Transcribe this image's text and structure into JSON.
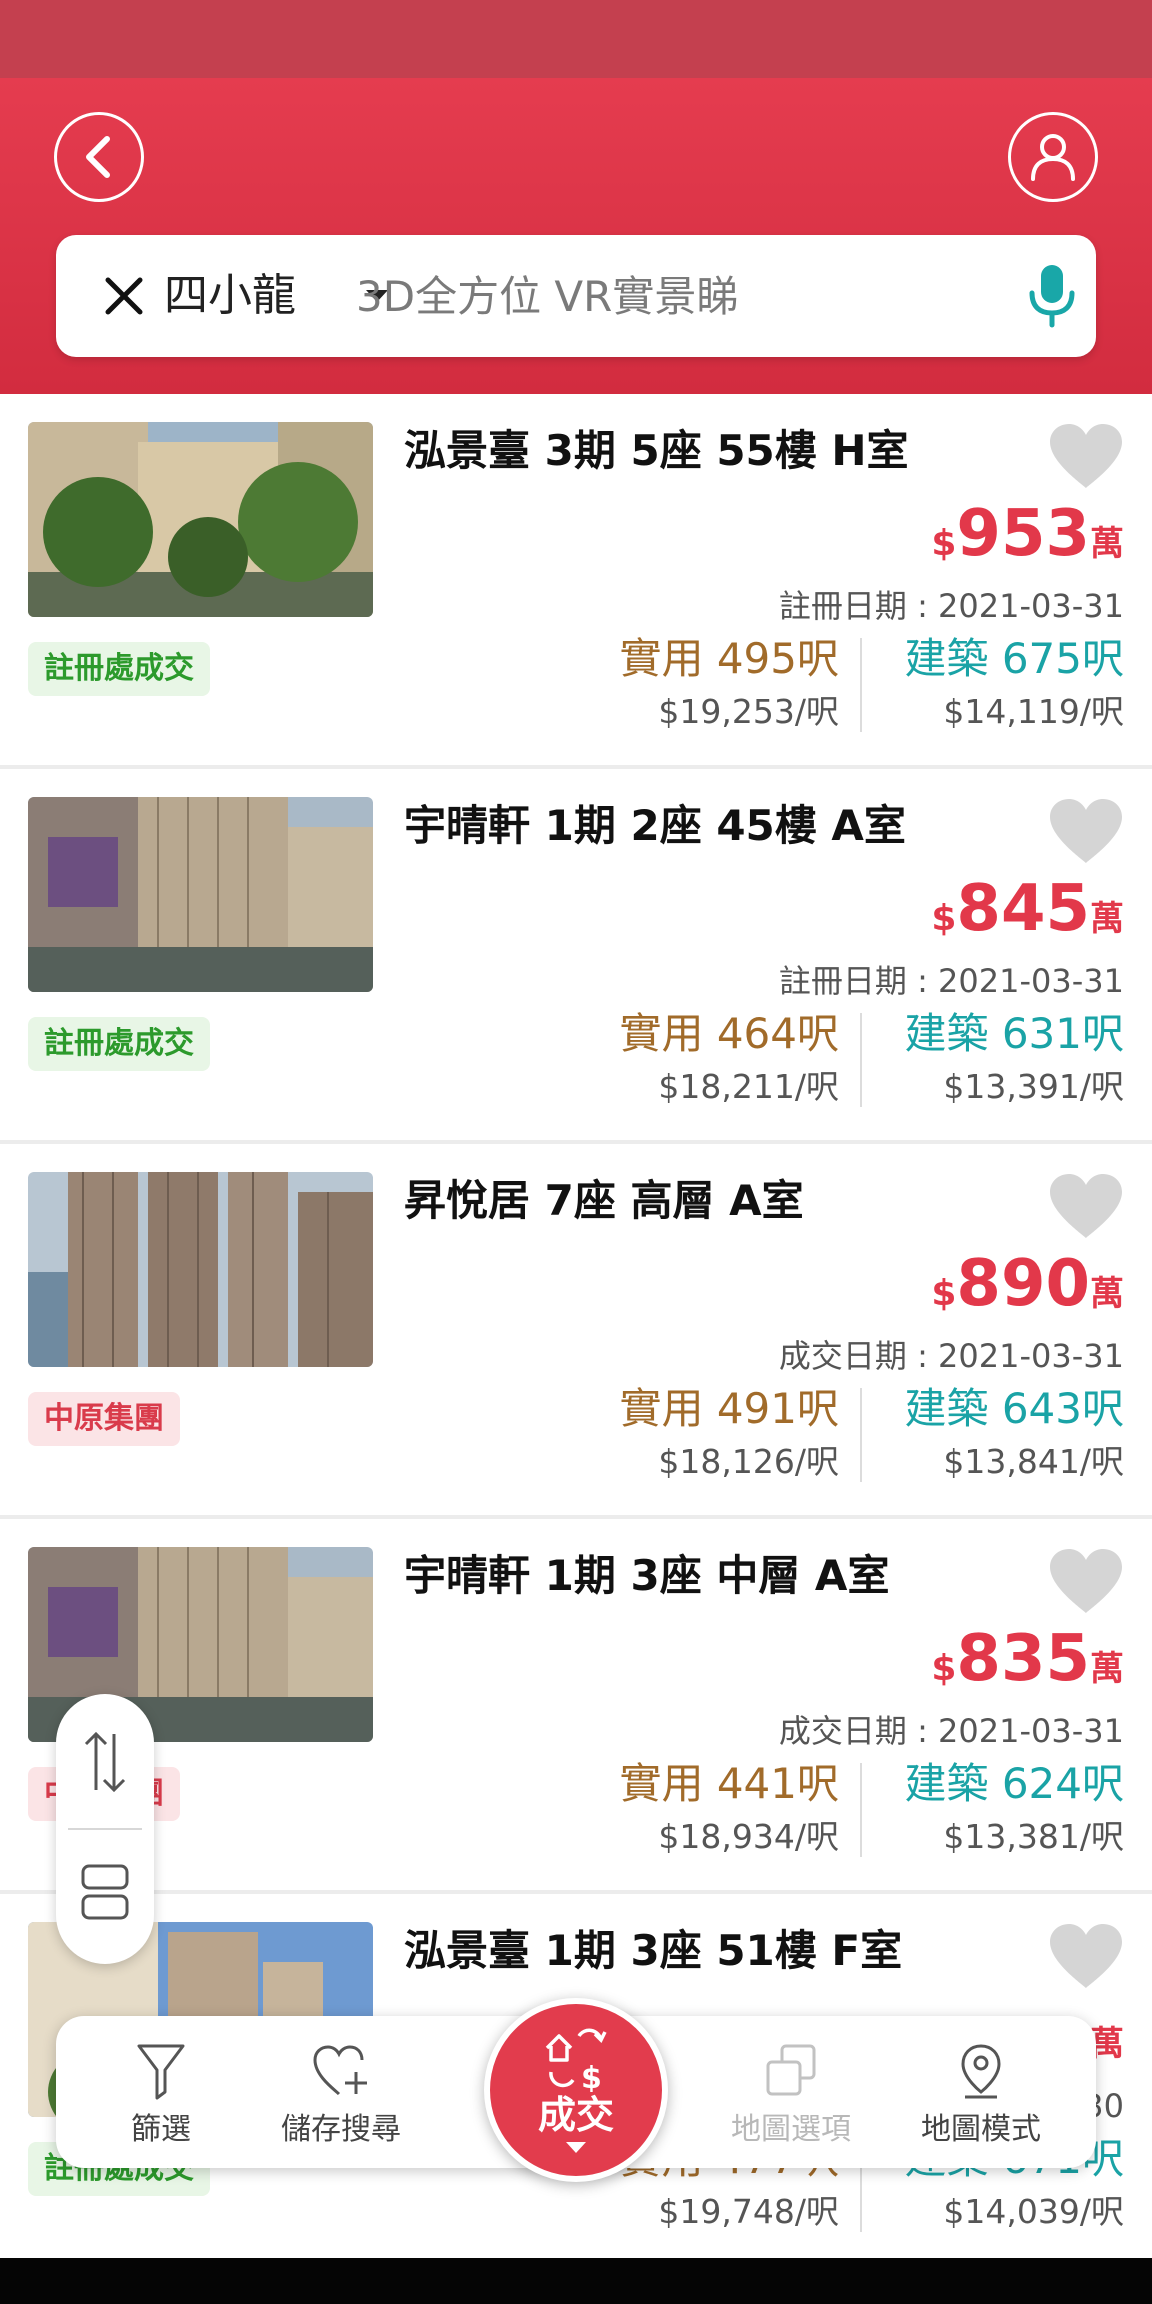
{
  "header": {
    "back_icon": "chevron-left-icon",
    "user_icon": "user-icon"
  },
  "search": {
    "area": "四小龍",
    "placeholder": "3D全方位 VR實景睇",
    "clear_icon": "close-icon",
    "mic_icon": "microphone-icon"
  },
  "colors": {
    "brand_red": "#e23c4d",
    "saleable_brown": "#a16b2a",
    "gross_teal": "#1aa3a6",
    "tag_green": "#2c9a2c"
  },
  "listings": [
    {
      "title": "泓景臺 3期 5座 55樓 H室",
      "currency": "$",
      "price": "953",
      "price_unit": "萬",
      "date": "註冊日期 : 2021-03-31",
      "saleable": "實用 495呎",
      "saleable_ppsf": "$19,253/呎",
      "gross": "建築 675呎",
      "gross_ppsf": "$14,119/呎",
      "tag": "註冊處成交",
      "tag_style": "green"
    },
    {
      "title": "宇晴軒 1期 2座 45樓 A室",
      "currency": "$",
      "price": "845",
      "price_unit": "萬",
      "date": "註冊日期 : 2021-03-31",
      "saleable": "實用 464呎",
      "saleable_ppsf": "$18,211/呎",
      "gross": "建築 631呎",
      "gross_ppsf": "$13,391/呎",
      "tag": "註冊處成交",
      "tag_style": "green"
    },
    {
      "title": "昇悅居 7座 高層 A室",
      "currency": "$",
      "price": "890",
      "price_unit": "萬",
      "date": "成交日期 : 2021-03-31",
      "saleable": "實用 491呎",
      "saleable_ppsf": "$18,126/呎",
      "gross": "建築 643呎",
      "gross_ppsf": "$13,841/呎",
      "tag": "中原集團",
      "tag_style": "red"
    },
    {
      "title": "宇晴軒 1期 3座 中層 A室",
      "currency": "$",
      "price": "835",
      "price_unit": "萬",
      "date": "成交日期 : 2021-03-31",
      "saleable": "實用 441呎",
      "saleable_ppsf": "$18,934/呎",
      "gross": "建築 624呎",
      "gross_ppsf": "$13,381/呎",
      "tag": "中原集團",
      "tag_style": "red"
    },
    {
      "title": "泓景臺 1期 3座 51樓 F室",
      "currency": "$",
      "price": "",
      "price_unit": "萬",
      "date": "30",
      "saleable": "實用 477呎",
      "saleable_ppsf": "$19,748/呎",
      "gross": "建築 671呎",
      "gross_ppsf": "$14,039/呎",
      "tag": "註冊處成交",
      "tag_style": "green"
    }
  ],
  "bottom_nav": {
    "filter": "篩選",
    "save_search": "儲存搜尋",
    "transactions": "成交",
    "map_options": "地圖選項",
    "map_mode": "地圖模式"
  }
}
